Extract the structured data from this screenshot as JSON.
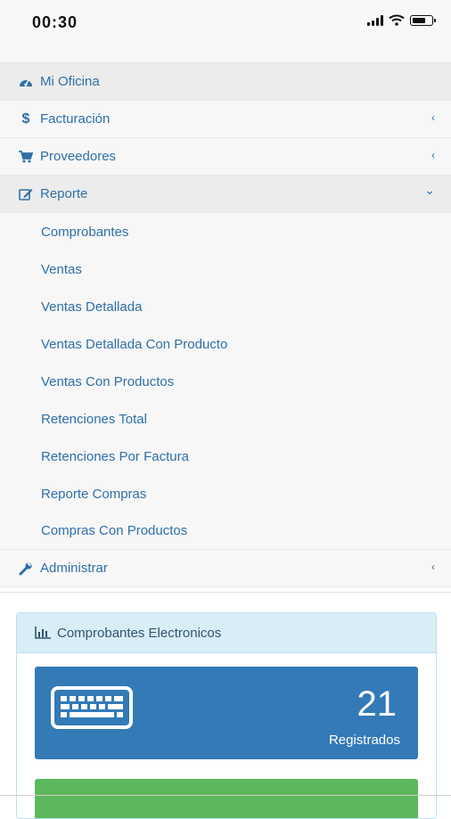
{
  "status_bar": {
    "time": "00:30"
  },
  "menu": {
    "items": [
      {
        "label": "Mi Oficina",
        "icon": "dashboard-icon",
        "chevron": ""
      },
      {
        "label": "Facturación",
        "icon": "dollar-icon",
        "chevron": "‹"
      },
      {
        "label": "Proveedores",
        "icon": "cart-icon",
        "chevron": "‹"
      },
      {
        "label": "Reporte",
        "icon": "edit-icon",
        "chevron": "⌄"
      },
      {
        "label": "Administrar",
        "icon": "wrench-icon",
        "chevron": "‹"
      }
    ],
    "reporte_submenu": [
      "Comprobantes",
      "Ventas",
      "Ventas Detallada",
      "Ventas Detallada Con Producto",
      "Ventas Con Productos",
      "Retenciones Total",
      "Retenciones Por Factura",
      "Reporte Compras",
      "Compras Con Productos"
    ]
  },
  "panel": {
    "title": "Comprobantes Electronicos",
    "title_icon": "bar-chart-icon",
    "stat": {
      "value": "21",
      "label": "Registrados",
      "icon": "keyboard-icon"
    }
  },
  "colors": {
    "link": "#2f6fa8",
    "primary": "#337ab7",
    "success": "#5cb85c",
    "panel_header": "#d9edf7"
  }
}
